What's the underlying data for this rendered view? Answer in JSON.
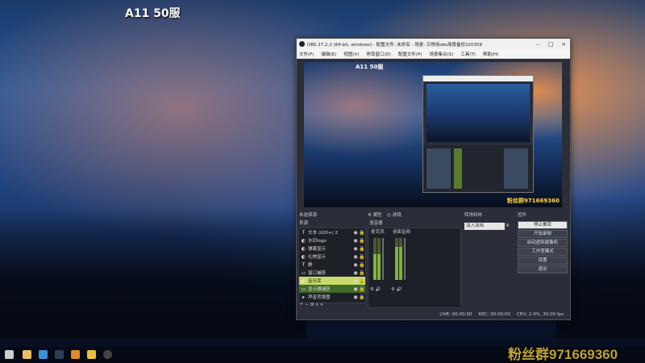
{
  "overlay": {
    "title": "A11 50服",
    "group": "粉丝群971669360"
  },
  "obs": {
    "title": "OBS 27.2.2 (64-bit, windows) - 配置文件: 未命名 - 场景: 日常用obs场景备份220309",
    "menu": [
      "文件(F)",
      "编辑(E)",
      "视图(V)",
      "停靠窗口(D)",
      "配置文件(P)",
      "场景集合(S)",
      "工具(T)",
      "帮助(H)"
    ],
    "docks": {
      "scenes_header": "未选择源",
      "properties_label": "属性",
      "filters_label": "滤镜",
      "sources_header": "来源",
      "mixer_header": "混音器",
      "transitions_header": "转场特效",
      "controls_header": "控件"
    },
    "sources": [
      {
        "icon": "T",
        "name": "文本 (GDI+) 2"
      },
      {
        "icon": "◐",
        "name": "水印logo"
      },
      {
        "icon": "◐",
        "name": "弹幕显示"
      },
      {
        "icon": "◐",
        "name": "礼物显示"
      },
      {
        "icon": "T",
        "name": "群"
      },
      {
        "icon": "▭",
        "name": "窗口捕获"
      },
      {
        "icon": "◐",
        "name": "音乐库"
      },
      {
        "icon": "▭",
        "name": "显示器捕获"
      },
      {
        "icon": "▸",
        "name": "声音背景图"
      }
    ],
    "mixer": [
      {
        "name": "麦克风",
        "db": "0.0 dB",
        "level": 0.62
      },
      {
        "name": "桌面音频",
        "db": "-5.1 dB",
        "level": 0.78
      }
    ],
    "transition": {
      "selected": "淡入淡出"
    },
    "controls": [
      "停止推流",
      "开始录制",
      "启动虚拟摄像机",
      "工作室模式",
      "设置",
      "退出"
    ],
    "status": {
      "live": "LIVE: 00:00:00",
      "rec": "REC: 00:00:00",
      "cpu": "CPU: 2.4%, 30.00 fps"
    },
    "preview_overlay_title": "A11 50服",
    "preview_overlay_group": "粉丝群971669360"
  },
  "taskbar": {
    "icons": [
      "start-icon",
      "file-explorer-icon",
      "edge-icon",
      "steam-icon",
      "orange-app-icon",
      "yellow-app-icon",
      "obs-icon"
    ]
  }
}
